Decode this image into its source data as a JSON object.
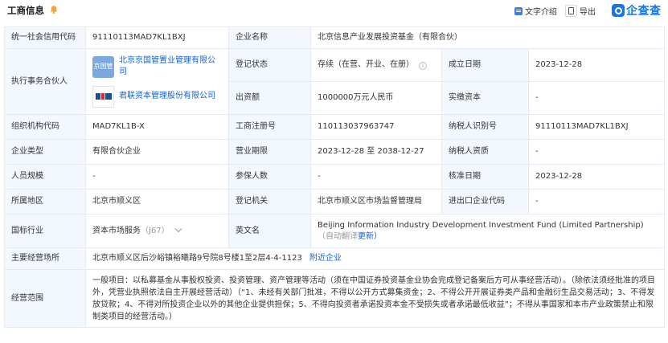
{
  "header": {
    "title": "工商信息",
    "text_intro_label": "文字介绍",
    "export_label": "导出",
    "brand": "企查查"
  },
  "rows": {
    "credit_code_label": "统一社会信用代码",
    "credit_code": "91110113MAD7KL1BXJ",
    "company_name_label": "企业名称",
    "company_name": "北京信息产业发展投资基金（有限合伙）",
    "partner_label": "执行事务合伙人",
    "partners": [
      {
        "logo_text": "京国管",
        "name": "北京京国管置业管理有限公司"
      },
      {
        "logo_text": "",
        "name": "君联资本管理股份有限公司"
      }
    ],
    "reg_status_label": "登记状态",
    "reg_status": "存续（在营、开业、在册）",
    "est_date_label": "成立日期",
    "est_date": "2023-12-28",
    "capital_label": "出资额",
    "capital": "1000000万元人民币",
    "paid_capital_label": "实缴资本",
    "paid_capital": "-",
    "org_code_label": "组织机构代码",
    "org_code": "MAD7KL1B-X",
    "reg_no_label": "工商注册号",
    "reg_no": "110113037963747",
    "taxpayer_id_label": "纳税人识别号",
    "taxpayer_id": "91110113MAD7KL1BXJ",
    "type_label": "企业类型",
    "type": "有限合伙企业",
    "term_label": "营业期限",
    "term": "2023-12-28 至 2038-12-27",
    "taxpayer_qual_label": "纳税人资质",
    "taxpayer_qual": "-",
    "staff_label": "人员规模",
    "staff": "-",
    "insured_label": "参保人数",
    "insured": "-",
    "approval_date_label": "核准日期",
    "approval_date": "2023-12-28",
    "region_label": "所属地区",
    "region": "北京市顺义区",
    "authority_label": "登记机关",
    "authority": "北京市顺义区市场监督管理局",
    "import_export_label": "进出口企业代码",
    "import_export": "-",
    "industry_label": "国标行业",
    "industry": "资本市场服务",
    "industry_code": "（J67）",
    "english_name_label": "英文名",
    "english_name": "Beijing Information Industry Development Investment Fund (Limited Partnership)",
    "english_auto": "（自动翻译",
    "english_update": "更新）",
    "address_label": "主要经营场所",
    "address": "北京市顺义区后沙峪镇裕曦路9号院8号楼1至2层4-4-1123",
    "nearby": "附近企业",
    "scope_label": "经营范围",
    "scope": "一般项目：以私募基金从事股权投资、投资管理、资产管理等活动（须在中国证券投资基金业协会完成登记备案后方可从事经营活动）。（除依法须经批准的项目外，凭营业执照依法自主开展经营活动）（“1、未经有关部门批准，不得以公开方式募集资金；2、不得公开开展证券类产品和金融衍生品交易活动；3、不得发放贷款；4、不得对所投资企业以外的其他企业提供担保；5、不得向投资者承诺投资本金不受损失或者承诺最低收益”；不得从事国家和本市产业政策禁止和限制类项目的经营活动。）"
  }
}
